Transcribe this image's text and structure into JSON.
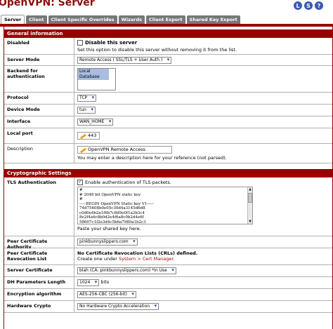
{
  "page": {
    "title": "OpenVPN: Server"
  },
  "top_icons": [
    {
      "name": "log-icon",
      "glyph": "L"
    },
    {
      "name": "status-icon",
      "glyph": "S"
    },
    {
      "name": "help-icon",
      "glyph": "?"
    }
  ],
  "tabs": [
    "Server",
    "Client",
    "Client Specific Overrides",
    "Wizards",
    "Client Export",
    "Shared Key Export"
  ],
  "general": {
    "header": "General information",
    "disabled": {
      "label": "Disabled",
      "checkbox_label": "Disable this server",
      "hint": "Set this option to disable this server without removing it from the list."
    },
    "server_mode": {
      "label": "Server Mode",
      "value": "Remote Access ( SSL/TLS + User Auth )"
    },
    "backend": {
      "label": "Backend for authentication",
      "option": "Local Database"
    },
    "protocol": {
      "label": "Protocol",
      "value": "TCP"
    },
    "device_mode": {
      "label": "Device Mode",
      "value": "tun"
    },
    "interface": {
      "label": "Interface",
      "value": "WAN_HOME"
    },
    "local_port": {
      "label": "Local port",
      "value": "443"
    },
    "description": {
      "label": "Description",
      "value": "OpenVPN Remote Access",
      "hint": "You may enter a description here for your reference (not parsed)."
    }
  },
  "crypto": {
    "header": "Cryptographic Settings",
    "tls_auth": {
      "label": "TLS Authentication",
      "checkbox_label": "Enable authentication of TLS packets.",
      "key_lines": [
        "#",
        "# 2048 bit OpenVPN static key",
        "#",
        "-----BEGIN OpenVPN Static key V1-----",
        "74d75608b0e05c30d4a3145d6d8",
        "c0d0e4b2a1f6b7c8d9e0f1a2b3c4",
        "8e2f4a6c8b0d2e4f6a8c0b2d4e6f",
        "58607c1f2e3d4c5b6a7980a1b2c3"
      ],
      "hint": "Paste your shared key here."
    },
    "peer_ca": {
      "label": "Peer Certificate Authority",
      "value": "pinkbunnyslippers.com"
    },
    "peer_crl": {
      "label": "Peer Certificate Revocation List",
      "bold_text": "No Certificate Revocation Lists (CRLs) defined.",
      "hint_prefix": "Create one under ",
      "hint_link": "System > Cert Manager",
      "hint_suffix": "."
    },
    "server_cert": {
      "label": "Server Certificate",
      "value": "blah (CA: pinkbunnyslippers.com) *In Use"
    },
    "dh_length": {
      "label": "DH Parameters Length",
      "value": "1024",
      "unit": "bits"
    },
    "encryption": {
      "label": "Encryption algorithm",
      "value": "AES-256-CBC (256-bit)"
    },
    "hw_crypto": {
      "label": "Hardware Crypto",
      "value": "No Hardware Crypto Acceleration"
    }
  }
}
